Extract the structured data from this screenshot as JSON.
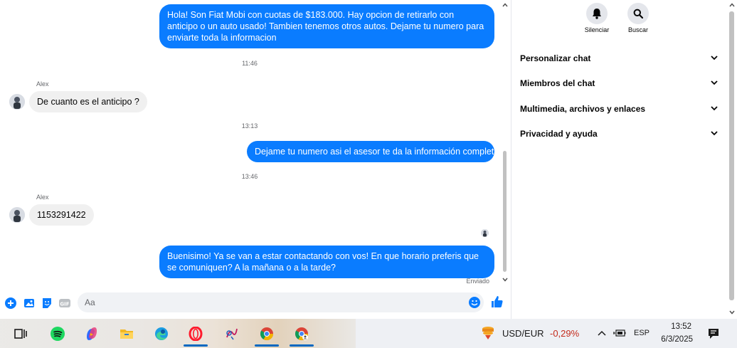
{
  "chat": {
    "messages": [
      {
        "type": "out",
        "text": "Hola! Son Fiat Mobi con cuotas de $183.000. Hay opcion de retirarlo con anticipo o un auto usado! Tambien tenemos otros autos. Dejame tu numero para enviarte toda la informacion"
      },
      {
        "type": "time",
        "text": "11:46"
      },
      {
        "type": "sender",
        "text": "Alex"
      },
      {
        "type": "in",
        "text": "De cuanto es el anticipo ?"
      },
      {
        "type": "time",
        "text": "13:13"
      },
      {
        "type": "out",
        "text": "Dejame tu numero asi el asesor te da la información completa"
      },
      {
        "type": "time",
        "text": "13:46"
      },
      {
        "type": "sender",
        "text": "Alex"
      },
      {
        "type": "in",
        "text": "1153291422"
      },
      {
        "type": "out",
        "text": "Buenisimo! Ya se van a estar contactando con vos! En que horario preferis que se comuniquen? A la mañana o a la tarde?"
      }
    ],
    "status_text": "Enviado",
    "composer_placeholder": "Aa"
  },
  "details": {
    "actions": [
      {
        "label": "Silenciar",
        "icon": "bell-icon"
      },
      {
        "label": "Buscar",
        "icon": "search-icon"
      }
    ],
    "sections": [
      "Personalizar chat",
      "Miembros del chat",
      "Multimedia, archivos y enlaces",
      "Privacidad y ayuda"
    ]
  },
  "taskbar": {
    "apps": [
      "task-view",
      "spotify",
      "copilot",
      "file-explorer",
      "edge",
      "opera",
      "app-7",
      "chrome",
      "chrome-profile"
    ],
    "ticker_label": "USD/EUR",
    "ticker_change": "-0,29%",
    "language": "ESP",
    "time": "13:52",
    "date": "6/3/2025"
  },
  "colors": {
    "accent": "#0a7cff",
    "negative": "#c42b1c"
  }
}
